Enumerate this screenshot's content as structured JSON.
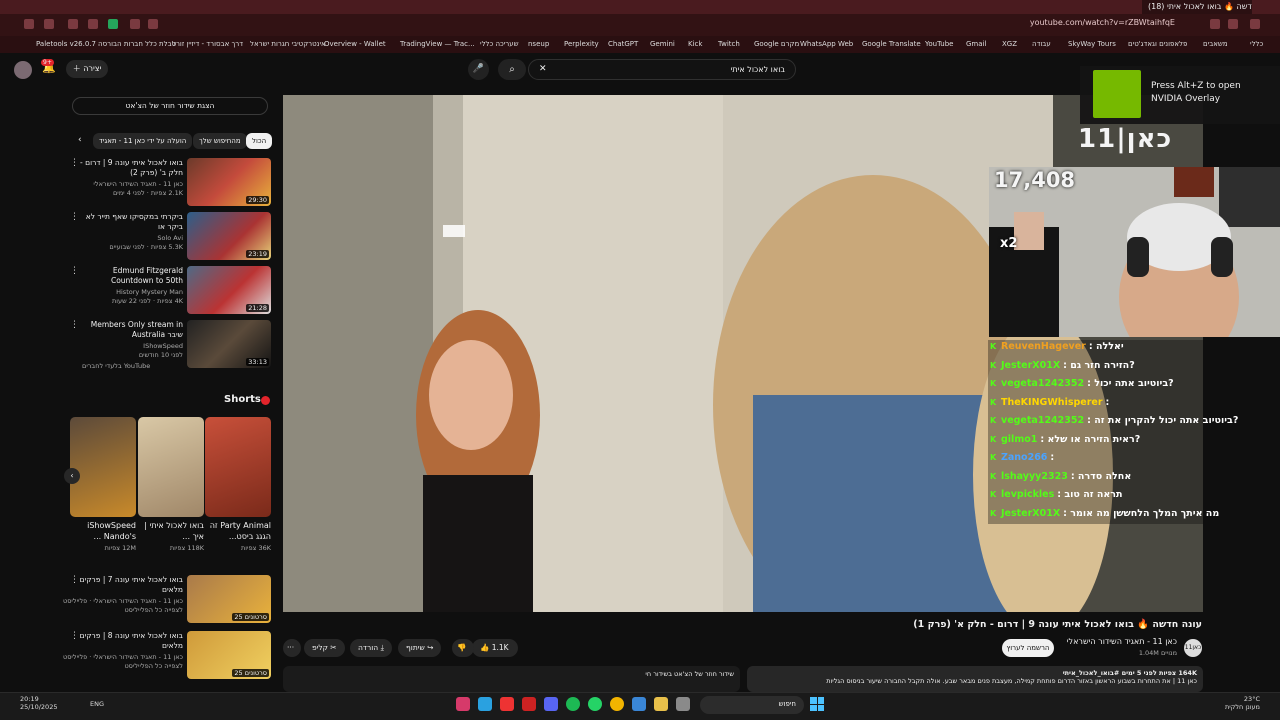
{
  "browser": {
    "tab_title": "(18) עונה חדשה 🔥 בואו לאכול איתי",
    "url": "youtube.com/watch?v=rZBWtaihfqE",
    "bookmarks": [
      "Paletools v26.0.7",
      "טבלת כלל חברות הבורסה",
      "דרך אבסורד - דיזיין זורל",
      "אינטרקטיבי חגרות ישראל",
      "Overview - Wallet",
      "TradingView — Trac...",
      "שעריכה כללי",
      "nseup",
      "Perplexity",
      "ChatGPT",
      "Gemini",
      "Kick",
      "Twitch",
      "Google מקרם",
      "WhatsApp Web",
      "Google Translate",
      "YouTube",
      "Gmail",
      "XGZ",
      "עבודה",
      "SkyWay Tours",
      "פלאפונים וגאדג'טים",
      "משאבים",
      "כללי"
    ]
  },
  "yt_header": {
    "search_value": "בואו לאכול איתי",
    "create_label": "יצירה",
    "notif_count": "9+"
  },
  "chat_replay_label": "הצגת שידור חוזר של הצ'אט",
  "chips": [
    {
      "label": "הכול",
      "active": true
    },
    {
      "label": "מהחיפוש שלך",
      "active": false
    },
    {
      "label": "הועלה על ידי כאן 11 - תאגיד",
      "active": false
    }
  ],
  "recommendations": [
    {
      "title": "בואו לאכול איתי עונה 9 | דרום - חלק ב' (פרק 2)",
      "channel": "כאן 11 - תאגיד השידור הישראלי",
      "meta": "2.1K צפיות · לפני 4 ימים",
      "duration": "29:30"
    },
    {
      "title": "ביקרתי במקסיקו שאף תייר לא ביקר או",
      "channel": "Solo Avi",
      "meta": "5.3K צפיות · לפני שבועיים",
      "duration": "23:19"
    },
    {
      "title": "Edmund Fitzgerald Countdown to 50th Commemoration ...",
      "channel": "History Mystery Man",
      "meta": "4K צפיות · לפני 22 שעות",
      "duration": "21:28"
    },
    {
      "title": "Members Only stream in Australia שיבר",
      "channel": "IShowSpeed",
      "meta": "לפני 10 חודשים",
      "duration": "33:13"
    }
  ],
  "members_note": "בלעדי לחברים",
  "shorts": {
    "title": "Shorts",
    "items": [
      {
        "title": "Party Animal זה הגגג ביסט...",
        "views": "36K צפיות"
      },
      {
        "title": "בואו לאכול איתי | איך ...",
        "views": "118K צפיות"
      },
      {
        "title": "iShowSpeed Nando's ...",
        "views": "12M צפיות"
      }
    ]
  },
  "more_recs": [
    {
      "title": "בואו לאכול איתי עונה 7 | פרקים מלאים",
      "channel": "כאן 11 - תאגיד השידור הישראלי · פלייליסט",
      "meta": "לצפייה כל הפלייליסט",
      "duration": "25 סרטונים"
    },
    {
      "title": "בואו לאכול איתי עונה 8 | פרקים מלאים",
      "channel": "כאן 11 - תאגיד השידור הישראלי · פלייליסט",
      "meta": "לצפייה כל הפלייליסט",
      "duration": "25 סרטונים"
    }
  ],
  "video": {
    "title": "עונה חדשה 🔥 בואו לאכול איתי עונה 9 | דרום - חלק א' (פרק 1)",
    "channel": "כאן 11 - תאגיד השידור הישראלי",
    "subscribers": "1.04M מנויים",
    "channel_badge": "כאן11",
    "subscribe_label": "הרשמה לערוץ",
    "likes": "1.1K",
    "share_label": "שיתוף",
    "download_label": "הורדה",
    "clip_label": "קליפ",
    "more_label": "···",
    "description_meta": "164K צפיות לפני 5 ימים #בואו_לאכול_איתי",
    "description": "כאן 11 | את התחרות בשבוע הראשון באזור הדרום פותחת קמילה, מעצבת פנים מבאר שבע. אולה תקבל החבורה שיעור בניסוס הגליות",
    "comments_hint": "שידור חוזר של הצ'אט בשידור חי"
  },
  "stream": {
    "overlay_title": "Press Alt+Z to open NVIDIA Overlay",
    "channel_logo": "כאן|11",
    "viewer_count": "17,408",
    "sub_badge": "x2",
    "chat": [
      {
        "user": "ReuvenHagever",
        "msg": "יאללה",
        "color": "#f0a020"
      },
      {
        "user": "JesterX01X",
        "msg": "הזירה חזר גם?",
        "color": "#53fc18"
      },
      {
        "user": "vegeta1242352",
        "msg": "ביוטיוב אתה יכול?",
        "color": "#53fc18"
      },
      {
        "user": "TheKINGWhisperer",
        "msg": "",
        "color": "#ffd700"
      },
      {
        "user": "vegeta1242352",
        "msg": "ביוטיוב אתה יכול להקרין את זה?",
        "color": "#53fc18"
      },
      {
        "user": "gilmo1",
        "msg": "ראית הזירה או שלא?",
        "color": "#53fc18"
      },
      {
        "user": "Zano266",
        "msg": "",
        "color": "#4aa3ff"
      },
      {
        "user": "lshayyy2323",
        "msg": "אחלה סדרה",
        "color": "#53fc18"
      },
      {
        "user": "levpickles",
        "msg": "תראה זה טוב",
        "color": "#53fc18"
      },
      {
        "user": "JesterX01X",
        "msg": "מה איתך המלך הלחששן מה אומר",
        "color": "#53fc18"
      }
    ]
  },
  "taskbar": {
    "time": "20:19",
    "date": "25/10/2025",
    "lang": "ENG",
    "search": "חיפוש",
    "temp": "23°C",
    "weather": "מעונן חלקית"
  }
}
